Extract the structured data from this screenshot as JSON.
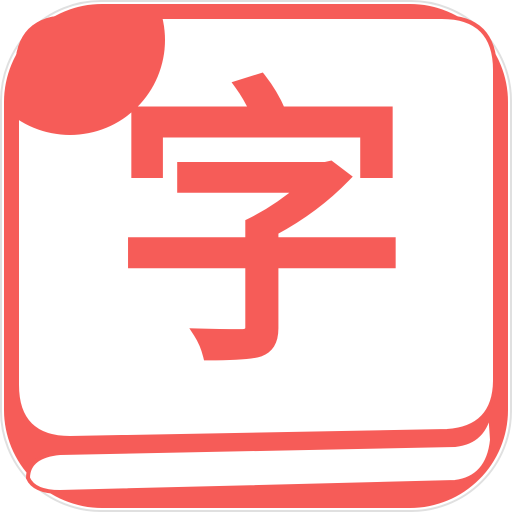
{
  "app_icon": {
    "glyph": "字",
    "icon_name": "dictionary-book-icon",
    "colors": {
      "accent": "#F65C58",
      "background": "#FFFFFF",
      "outer_border": "#E0E0E0"
    }
  }
}
